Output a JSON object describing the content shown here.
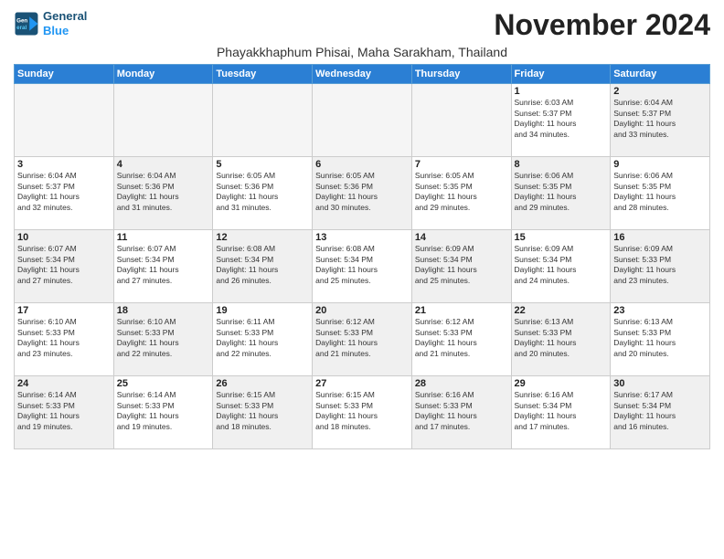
{
  "header": {
    "logo_line1": "General",
    "logo_line2": "Blue",
    "month": "November 2024",
    "location": "Phayakkhaphum Phisai, Maha Sarakham, Thailand"
  },
  "days_of_week": [
    "Sunday",
    "Monday",
    "Tuesday",
    "Wednesday",
    "Thursday",
    "Friday",
    "Saturday"
  ],
  "weeks": [
    [
      {
        "day": "",
        "info": "",
        "empty": true
      },
      {
        "day": "",
        "info": "",
        "empty": true
      },
      {
        "day": "",
        "info": "",
        "empty": true
      },
      {
        "day": "",
        "info": "",
        "empty": true
      },
      {
        "day": "",
        "info": "",
        "empty": true
      },
      {
        "day": "1",
        "info": "Sunrise: 6:03 AM\nSunset: 5:37 PM\nDaylight: 11 hours\nand 34 minutes."
      },
      {
        "day": "2",
        "info": "Sunrise: 6:04 AM\nSunset: 5:37 PM\nDaylight: 11 hours\nand 33 minutes."
      }
    ],
    [
      {
        "day": "3",
        "info": "Sunrise: 6:04 AM\nSunset: 5:37 PM\nDaylight: 11 hours\nand 32 minutes."
      },
      {
        "day": "4",
        "info": "Sunrise: 6:04 AM\nSunset: 5:36 PM\nDaylight: 11 hours\nand 31 minutes."
      },
      {
        "day": "5",
        "info": "Sunrise: 6:05 AM\nSunset: 5:36 PM\nDaylight: 11 hours\nand 31 minutes."
      },
      {
        "day": "6",
        "info": "Sunrise: 6:05 AM\nSunset: 5:36 PM\nDaylight: 11 hours\nand 30 minutes."
      },
      {
        "day": "7",
        "info": "Sunrise: 6:05 AM\nSunset: 5:35 PM\nDaylight: 11 hours\nand 29 minutes."
      },
      {
        "day": "8",
        "info": "Sunrise: 6:06 AM\nSunset: 5:35 PM\nDaylight: 11 hours\nand 29 minutes."
      },
      {
        "day": "9",
        "info": "Sunrise: 6:06 AM\nSunset: 5:35 PM\nDaylight: 11 hours\nand 28 minutes."
      }
    ],
    [
      {
        "day": "10",
        "info": "Sunrise: 6:07 AM\nSunset: 5:34 PM\nDaylight: 11 hours\nand 27 minutes."
      },
      {
        "day": "11",
        "info": "Sunrise: 6:07 AM\nSunset: 5:34 PM\nDaylight: 11 hours\nand 27 minutes."
      },
      {
        "day": "12",
        "info": "Sunrise: 6:08 AM\nSunset: 5:34 PM\nDaylight: 11 hours\nand 26 minutes."
      },
      {
        "day": "13",
        "info": "Sunrise: 6:08 AM\nSunset: 5:34 PM\nDaylight: 11 hours\nand 25 minutes."
      },
      {
        "day": "14",
        "info": "Sunrise: 6:09 AM\nSunset: 5:34 PM\nDaylight: 11 hours\nand 25 minutes."
      },
      {
        "day": "15",
        "info": "Sunrise: 6:09 AM\nSunset: 5:34 PM\nDaylight: 11 hours\nand 24 minutes."
      },
      {
        "day": "16",
        "info": "Sunrise: 6:09 AM\nSunset: 5:33 PM\nDaylight: 11 hours\nand 23 minutes."
      }
    ],
    [
      {
        "day": "17",
        "info": "Sunrise: 6:10 AM\nSunset: 5:33 PM\nDaylight: 11 hours\nand 23 minutes."
      },
      {
        "day": "18",
        "info": "Sunrise: 6:10 AM\nSunset: 5:33 PM\nDaylight: 11 hours\nand 22 minutes."
      },
      {
        "day": "19",
        "info": "Sunrise: 6:11 AM\nSunset: 5:33 PM\nDaylight: 11 hours\nand 22 minutes."
      },
      {
        "day": "20",
        "info": "Sunrise: 6:12 AM\nSunset: 5:33 PM\nDaylight: 11 hours\nand 21 minutes."
      },
      {
        "day": "21",
        "info": "Sunrise: 6:12 AM\nSunset: 5:33 PM\nDaylight: 11 hours\nand 21 minutes."
      },
      {
        "day": "22",
        "info": "Sunrise: 6:13 AM\nSunset: 5:33 PM\nDaylight: 11 hours\nand 20 minutes."
      },
      {
        "day": "23",
        "info": "Sunrise: 6:13 AM\nSunset: 5:33 PM\nDaylight: 11 hours\nand 20 minutes."
      }
    ],
    [
      {
        "day": "24",
        "info": "Sunrise: 6:14 AM\nSunset: 5:33 PM\nDaylight: 11 hours\nand 19 minutes."
      },
      {
        "day": "25",
        "info": "Sunrise: 6:14 AM\nSunset: 5:33 PM\nDaylight: 11 hours\nand 19 minutes."
      },
      {
        "day": "26",
        "info": "Sunrise: 6:15 AM\nSunset: 5:33 PM\nDaylight: 11 hours\nand 18 minutes."
      },
      {
        "day": "27",
        "info": "Sunrise: 6:15 AM\nSunset: 5:33 PM\nDaylight: 11 hours\nand 18 minutes."
      },
      {
        "day": "28",
        "info": "Sunrise: 6:16 AM\nSunset: 5:33 PM\nDaylight: 11 hours\nand 17 minutes."
      },
      {
        "day": "29",
        "info": "Sunrise: 6:16 AM\nSunset: 5:34 PM\nDaylight: 11 hours\nand 17 minutes."
      },
      {
        "day": "30",
        "info": "Sunrise: 6:17 AM\nSunset: 5:34 PM\nDaylight: 11 hours\nand 16 minutes."
      }
    ]
  ]
}
